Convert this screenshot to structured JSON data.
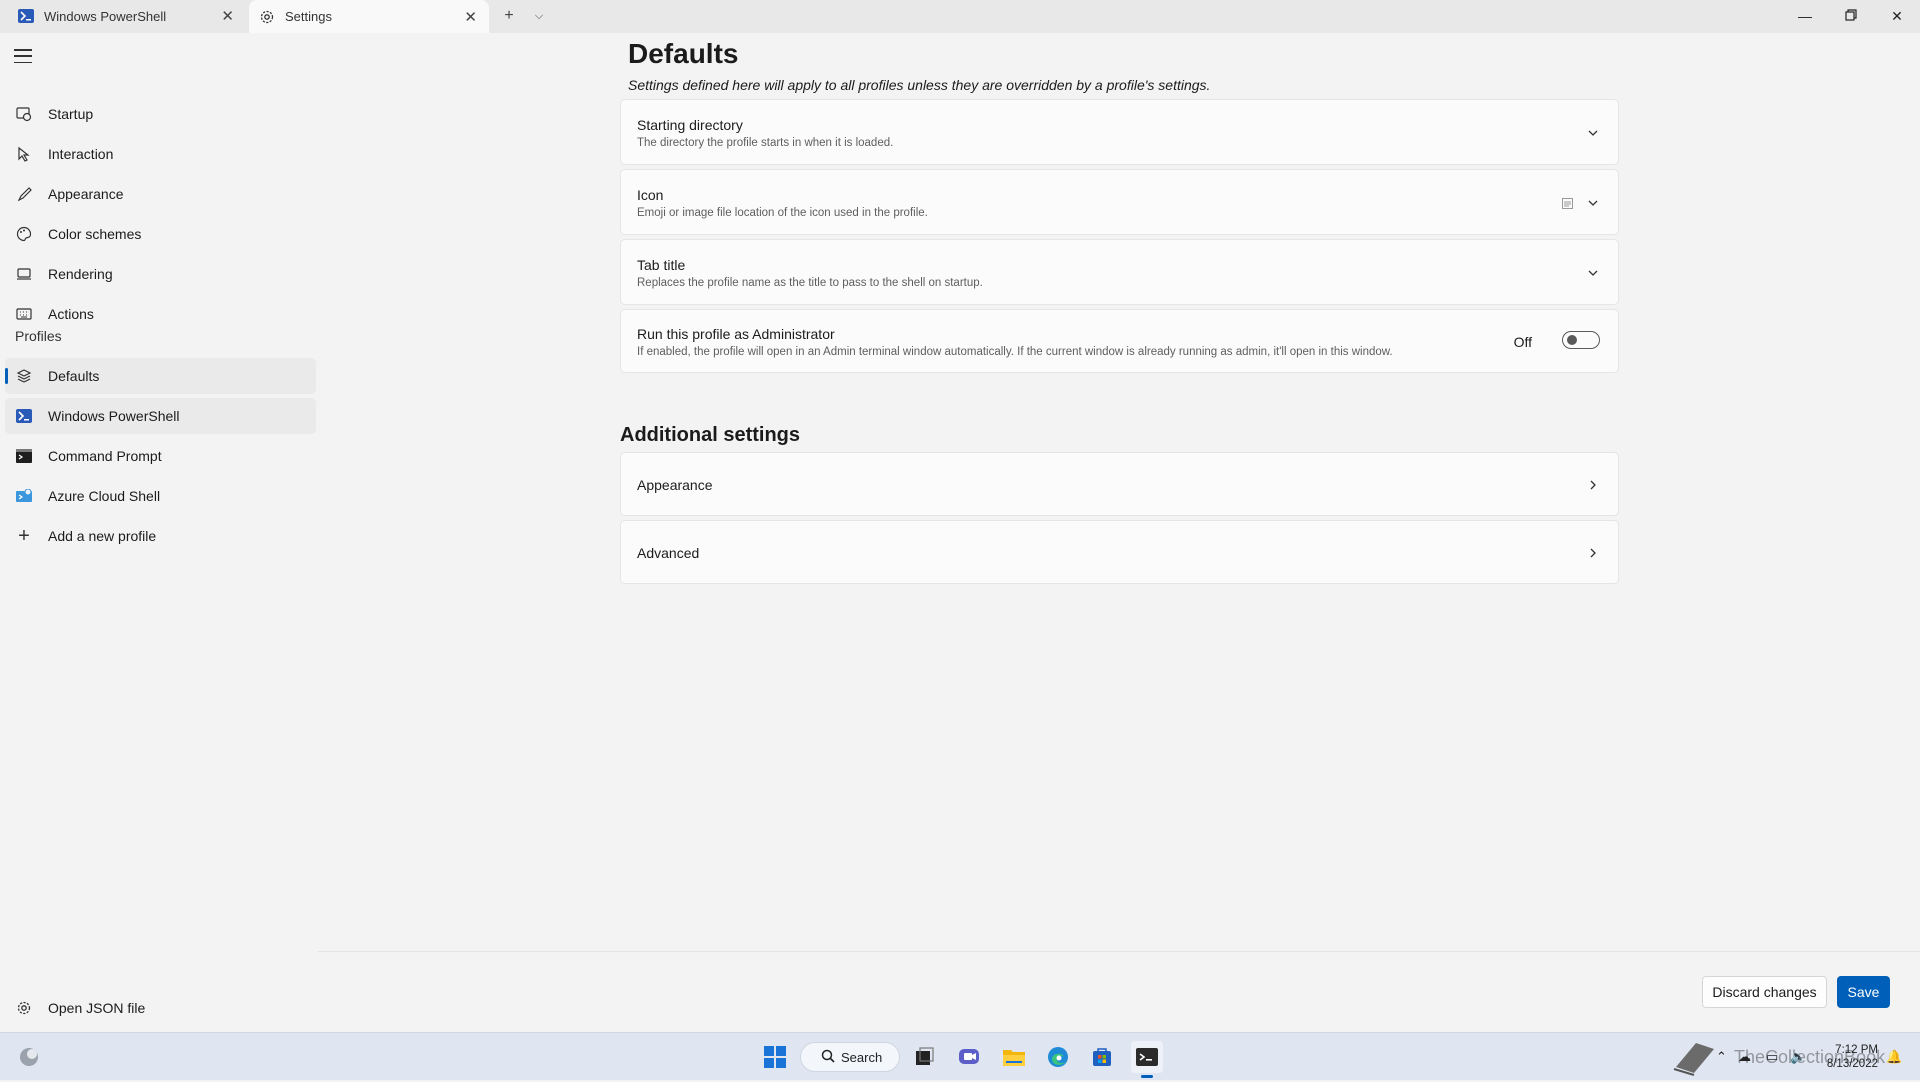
{
  "tabs": [
    {
      "label": "Windows PowerShell",
      "icon": "powershell-icon"
    },
    {
      "label": "Settings",
      "icon": "gear-icon"
    }
  ],
  "window_controls": [
    "minimize",
    "restore",
    "close"
  ],
  "sidebar": {
    "items": [
      {
        "label": "Startup",
        "icon": "startup-icon"
      },
      {
        "label": "Interaction",
        "icon": "interaction-icon"
      },
      {
        "label": "Appearance",
        "icon": "brush-icon"
      },
      {
        "label": "Color schemes",
        "icon": "palette-icon"
      },
      {
        "label": "Rendering",
        "icon": "monitor-icon"
      },
      {
        "label": "Actions",
        "icon": "keyboard-icon"
      }
    ],
    "profiles_header": "Profiles",
    "profiles": [
      {
        "label": "Defaults",
        "icon": "layers-icon",
        "selected": true
      },
      {
        "label": "Windows PowerShell",
        "icon": "powershell-icon"
      },
      {
        "label": "Command Prompt",
        "icon": "cmd-icon"
      },
      {
        "label": "Azure Cloud Shell",
        "icon": "azure-icon"
      },
      {
        "label": "Add a new profile",
        "icon": "plus-icon"
      }
    ],
    "open_json": {
      "label": "Open JSON file",
      "icon": "gear-icon"
    }
  },
  "main": {
    "title": "Defaults",
    "subtitle": "Settings defined here will apply to all profiles unless they are overridden by a profile's settings.",
    "settings": [
      {
        "title": "Starting directory",
        "desc": "The directory the profile starts in when it is loaded."
      },
      {
        "title": "Icon",
        "desc": "Emoji or image file location of the icon used in the profile."
      },
      {
        "title": "Tab title",
        "desc": "Replaces the profile name as the title to pass to the shell on startup."
      },
      {
        "title": "Run this profile as Administrator",
        "desc": "If enabled, the profile will open in an Admin terminal window automatically. If the current window is already running as admin, it'll open in this window.",
        "toggle_label": "Off",
        "toggle_on": false
      }
    ],
    "additional_title": "Additional settings",
    "additional": [
      {
        "title": "Appearance"
      },
      {
        "title": "Advanced"
      }
    ]
  },
  "footer": {
    "discard_label": "Discard changes",
    "save_label": "Save"
  },
  "taskbar": {
    "search_label": "Search",
    "time": "7:12 PM",
    "date": "8/13/2022",
    "watermark": "TheCollectionBook"
  },
  "colors": {
    "accent": "#005fb8",
    "background": "#f3f3f3",
    "card": "#fbfbfb"
  }
}
